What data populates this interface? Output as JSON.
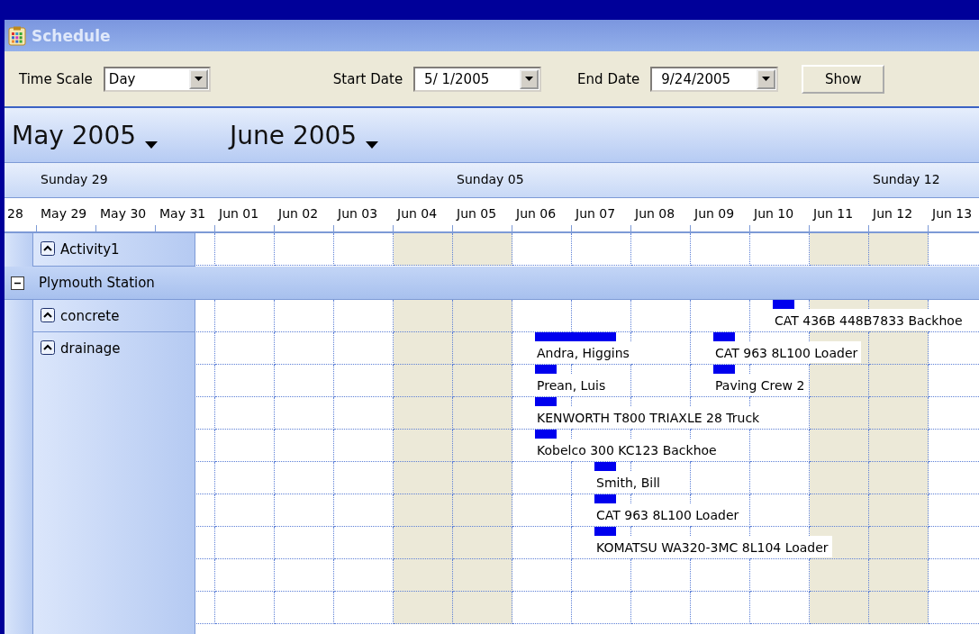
{
  "window": {
    "title": "Schedule"
  },
  "toolbar": {
    "time_scale": {
      "label": "Time Scale",
      "value": "Day"
    },
    "start_date": {
      "label": "Start Date",
      "value": "5/ 1/2005"
    },
    "end_date": {
      "label": "End Date",
      "value": "9/24/2005"
    },
    "show_button": "Show"
  },
  "timeline": {
    "months": [
      "May 2005",
      "June 2005"
    ],
    "weeks": [
      "Sunday 29",
      "Sunday 05",
      "Sunday 12"
    ],
    "days": [
      {
        "label": "28"
      },
      {
        "label": "May 29"
      },
      {
        "label": "May 30"
      },
      {
        "label": "May 31",
        "weekend": false
      },
      {
        "label": "Jun 01",
        "weekend": false
      },
      {
        "label": "Jun 02",
        "weekend": false
      },
      {
        "label": "Jun 03",
        "weekend": false
      },
      {
        "label": "Jun 04",
        "weekend": true
      },
      {
        "label": "Jun 05",
        "weekend": true
      },
      {
        "label": "Jun 06",
        "weekend": false
      },
      {
        "label": "Jun 07",
        "weekend": false
      },
      {
        "label": "Jun 08",
        "weekend": false
      },
      {
        "label": "Jun 09",
        "weekend": false
      },
      {
        "label": "Jun 10",
        "weekend": false
      },
      {
        "label": "Jun 11",
        "weekend": true
      },
      {
        "label": "Jun 12",
        "weekend": true
      },
      {
        "label": "Jun 13",
        "weekend": false
      }
    ]
  },
  "resources": [
    {
      "kind": "resource",
      "name": "Activity1",
      "expanded": false
    },
    {
      "kind": "group",
      "name": "Plymouth Station",
      "expanded": true,
      "children": [
        {
          "name": "concrete",
          "expanded": false,
          "lines": [
            [
              {
                "label": "CAT 436B 448B7833 Backhoe"
              }
            ]
          ]
        },
        {
          "name": "drainage",
          "expanded": false,
          "lines": [
            [
              {
                "label": "Andra, Higgins"
              },
              {
                "label": "CAT 963 8L100 Loader"
              }
            ],
            [
              {
                "label": "Prean, Luis"
              },
              {
                "label": "Paving Crew 2"
              }
            ],
            [
              {
                "label": "KENWORTH T800 TRIAXLE 28 Truck"
              }
            ],
            [
              {
                "label": "Kobelco 300 KC123 Backhoe"
              }
            ],
            [
              {
                "label": "Smith, Bill"
              }
            ],
            [
              {
                "label": "CAT 963 8L100 Loader"
              }
            ],
            [
              {
                "label": "KOMATSU WA320-3MC 8L104 Loader"
              }
            ]
          ]
        }
      ]
    }
  ]
}
